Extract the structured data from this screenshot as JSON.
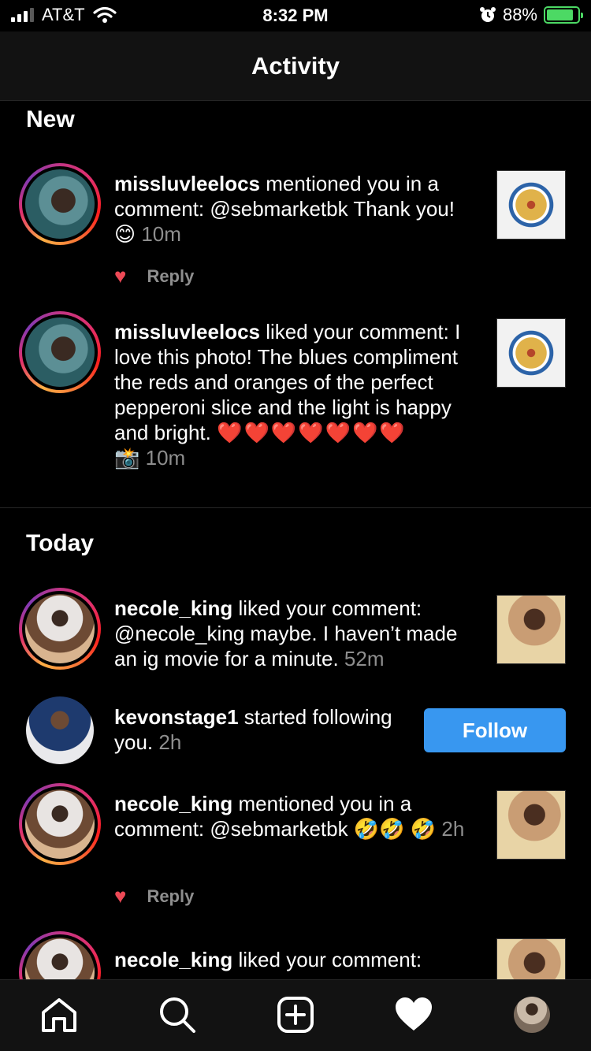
{
  "status_bar": {
    "carrier": "AT&T",
    "time": "8:32 PM",
    "battery": "88%",
    "battery_level": 0.88
  },
  "header": {
    "title": "Activity"
  },
  "sections": {
    "new_title": "New",
    "today_title": "Today"
  },
  "items": [
    {
      "username": "missluvleelocs",
      "text": " mentioned you in a comment: @sebmarketbk Thank you! ",
      "emoji": "😊",
      "time": "10m",
      "reply_label": "Reply"
    },
    {
      "username": "missluvleelocs",
      "text": " liked your comment: I love this photo! The blues compliment the reds and oranges of the perfect pepperoni slice and  the light is happy and bright. ",
      "emoji": "❤️❤️❤️❤️❤️❤️❤️",
      "camera": "📸",
      "time": "10m"
    },
    {
      "username": "necole_king",
      "text": " liked your comment: @necole_king maybe. I haven’t made an ig movie for a minute. ",
      "time": "52m"
    },
    {
      "username": "kevonstage1",
      "text": " started following you. ",
      "time": "2h",
      "button_label": "Follow"
    },
    {
      "username": "necole_king",
      "text": " mentioned you in a comment: @sebmarketbk ",
      "emoji": "🤣🤣 🤣",
      "time": "2h",
      "reply_label": "Reply"
    },
    {
      "username": "necole_king",
      "text": " liked your comment:"
    }
  ],
  "tabbar": {
    "icons": [
      "home-icon",
      "search-icon",
      "new-post-icon",
      "heart-icon",
      "profile-avatar"
    ]
  },
  "colors": {
    "accent": "#3897f0",
    "like_red": "#ed4956",
    "muted": "#8e8e8e",
    "battery_green": "#4cd964"
  }
}
